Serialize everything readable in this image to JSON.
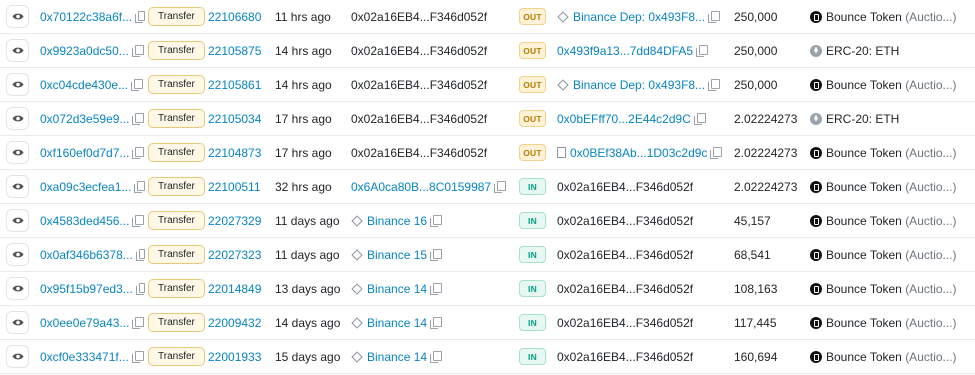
{
  "rows": [
    {
      "hash": "0x70122c38a6f...",
      "method": "Transfer",
      "block": "22106680",
      "age": "11 hrs ago",
      "from": "0x02a16EB4...F346d052f",
      "from_type": "plain",
      "dir": "OUT",
      "to": "Binance Dep: 0x493F8...",
      "to_type": "labeled",
      "amount": "250,000",
      "token_name": "Bounce Token",
      "token_suffix": "(Auctio...)",
      "token_icon": "bounce-token-icon"
    },
    {
      "hash": "0x9923a0dc50...",
      "method": "Transfer",
      "block": "22105875",
      "age": "14 hrs ago",
      "from": "0x02a16EB4...F346d052f",
      "from_type": "plain",
      "dir": "OUT",
      "to": "0x493f9a13...7dd84DFA5",
      "to_type": "address",
      "amount": "250,000",
      "token_name": "ERC-20: ETH",
      "token_suffix": "",
      "token_icon": "eth-icon"
    },
    {
      "hash": "0xc04cde430e...",
      "method": "Transfer",
      "block": "22105861",
      "age": "14 hrs ago",
      "from": "0x02a16EB4...F346d052f",
      "from_type": "plain",
      "dir": "OUT",
      "to": "Binance Dep: 0x493F8...",
      "to_type": "labeled",
      "amount": "250,000",
      "token_name": "Bounce Token",
      "token_suffix": "(Auctio...)",
      "token_icon": "bounce-token-icon"
    },
    {
      "hash": "0x072d3e59e9...",
      "method": "Transfer",
      "block": "22105034",
      "age": "17 hrs ago",
      "from": "0x02a16EB4...F346d052f",
      "from_type": "plain",
      "dir": "OUT",
      "to": "0x0bEFff70...2E44c2d9C",
      "to_type": "address",
      "amount": "2.02224273",
      "token_name": "ERC-20: ETH",
      "token_suffix": "",
      "token_icon": "eth-icon"
    },
    {
      "hash": "0xf160ef0d7d7...",
      "method": "Transfer",
      "block": "22104873",
      "age": "17 hrs ago",
      "from": "0x02a16EB4...F346d052f",
      "from_type": "plain",
      "dir": "OUT",
      "to": "0x0BEf38Ab...1D03c2d9c",
      "to_type": "contract",
      "amount": "2.02224273",
      "token_name": "Bounce Token",
      "token_suffix": "(Auctio...)",
      "token_icon": "bounce-token-icon"
    },
    {
      "hash": "0xa09c3ecfea1...",
      "method": "Transfer",
      "block": "22100511",
      "age": "32 hrs ago",
      "from": "0x6A0ca80B...8C0159987",
      "from_type": "address",
      "dir": "IN",
      "to": "0x02a16EB4...F346d052f",
      "to_type": "plain",
      "amount": "2.02224273",
      "token_name": "Bounce Token",
      "token_suffix": "(Auctio...)",
      "token_icon": "bounce-token-icon"
    },
    {
      "hash": "0x4583ded456...",
      "method": "Transfer",
      "block": "22027329",
      "age": "11 days ago",
      "from": "Binance 16",
      "from_type": "labeled",
      "dir": "IN",
      "to": "0x02a16EB4...F346d052f",
      "to_type": "plain",
      "amount": "45,157",
      "token_name": "Bounce Token",
      "token_suffix": "(Auctio...)",
      "token_icon": "bounce-token-icon"
    },
    {
      "hash": "0x0af346b6378...",
      "method": "Transfer",
      "block": "22027323",
      "age": "11 days ago",
      "from": "Binance 15",
      "from_type": "labeled",
      "dir": "IN",
      "to": "0x02a16EB4...F346d052f",
      "to_type": "plain",
      "amount": "68,541",
      "token_name": "Bounce Token",
      "token_suffix": "(Auctio...)",
      "token_icon": "bounce-token-icon"
    },
    {
      "hash": "0x95f15b97ed3...",
      "method": "Transfer",
      "block": "22014849",
      "age": "13 days ago",
      "from": "Binance 14",
      "from_type": "labeled",
      "dir": "IN",
      "to": "0x02a16EB4...F346d052f",
      "to_type": "plain",
      "amount": "108,163",
      "token_name": "Bounce Token",
      "token_suffix": "(Auctio...)",
      "token_icon": "bounce-token-icon"
    },
    {
      "hash": "0x0ee0e79a43...",
      "method": "Transfer",
      "block": "22009432",
      "age": "14 days ago",
      "from": "Binance 14",
      "from_type": "labeled",
      "dir": "IN",
      "to": "0x02a16EB4...F346d052f",
      "to_type": "plain",
      "amount": "117,445",
      "token_name": "Bounce Token",
      "token_suffix": "(Auctio...)",
      "token_icon": "bounce-token-icon"
    },
    {
      "hash": "0xcf0e333471f...",
      "method": "Transfer",
      "block": "22001933",
      "age": "15 days ago",
      "from": "Binance 14",
      "from_type": "labeled",
      "dir": "IN",
      "to": "0x02a16EB4...F346d052f",
      "to_type": "plain",
      "amount": "160,694",
      "token_name": "Bounce Token",
      "token_suffix": "(Auctio...)",
      "token_icon": "bounce-token-icon"
    }
  ]
}
